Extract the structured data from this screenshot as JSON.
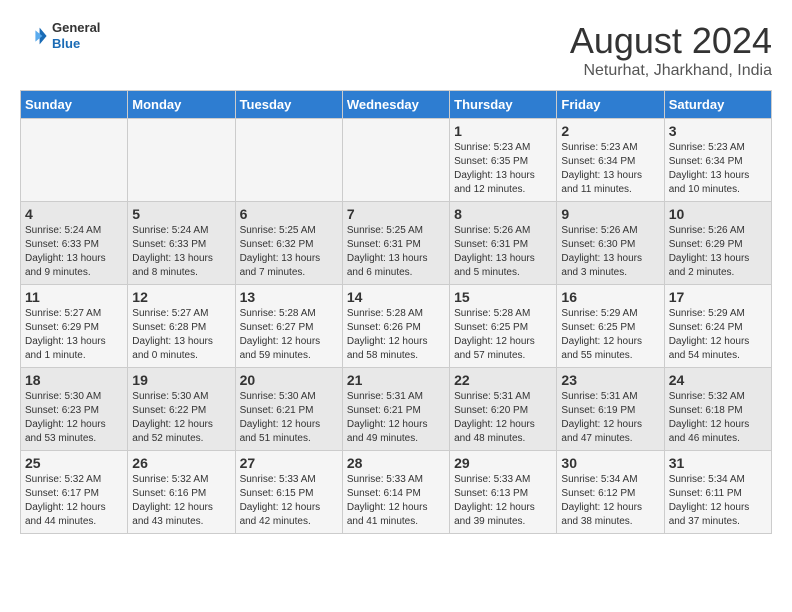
{
  "header": {
    "logo_general": "General",
    "logo_blue": "Blue",
    "title": "August 2024",
    "subtitle": "Neturhat, Jharkhand, India"
  },
  "calendar": {
    "days_of_week": [
      "Sunday",
      "Monday",
      "Tuesday",
      "Wednesday",
      "Thursday",
      "Friday",
      "Saturday"
    ],
    "weeks": [
      [
        {
          "day": "",
          "info": ""
        },
        {
          "day": "",
          "info": ""
        },
        {
          "day": "",
          "info": ""
        },
        {
          "day": "",
          "info": ""
        },
        {
          "day": "1",
          "info": "Sunrise: 5:23 AM\nSunset: 6:35 PM\nDaylight: 13 hours\nand 12 minutes."
        },
        {
          "day": "2",
          "info": "Sunrise: 5:23 AM\nSunset: 6:34 PM\nDaylight: 13 hours\nand 11 minutes."
        },
        {
          "day": "3",
          "info": "Sunrise: 5:23 AM\nSunset: 6:34 PM\nDaylight: 13 hours\nand 10 minutes."
        }
      ],
      [
        {
          "day": "4",
          "info": "Sunrise: 5:24 AM\nSunset: 6:33 PM\nDaylight: 13 hours\nand 9 minutes."
        },
        {
          "day": "5",
          "info": "Sunrise: 5:24 AM\nSunset: 6:33 PM\nDaylight: 13 hours\nand 8 minutes."
        },
        {
          "day": "6",
          "info": "Sunrise: 5:25 AM\nSunset: 6:32 PM\nDaylight: 13 hours\nand 7 minutes."
        },
        {
          "day": "7",
          "info": "Sunrise: 5:25 AM\nSunset: 6:31 PM\nDaylight: 13 hours\nand 6 minutes."
        },
        {
          "day": "8",
          "info": "Sunrise: 5:26 AM\nSunset: 6:31 PM\nDaylight: 13 hours\nand 5 minutes."
        },
        {
          "day": "9",
          "info": "Sunrise: 5:26 AM\nSunset: 6:30 PM\nDaylight: 13 hours\nand 3 minutes."
        },
        {
          "day": "10",
          "info": "Sunrise: 5:26 AM\nSunset: 6:29 PM\nDaylight: 13 hours\nand 2 minutes."
        }
      ],
      [
        {
          "day": "11",
          "info": "Sunrise: 5:27 AM\nSunset: 6:29 PM\nDaylight: 13 hours\nand 1 minute."
        },
        {
          "day": "12",
          "info": "Sunrise: 5:27 AM\nSunset: 6:28 PM\nDaylight: 13 hours\nand 0 minutes."
        },
        {
          "day": "13",
          "info": "Sunrise: 5:28 AM\nSunset: 6:27 PM\nDaylight: 12 hours\nand 59 minutes."
        },
        {
          "day": "14",
          "info": "Sunrise: 5:28 AM\nSunset: 6:26 PM\nDaylight: 12 hours\nand 58 minutes."
        },
        {
          "day": "15",
          "info": "Sunrise: 5:28 AM\nSunset: 6:25 PM\nDaylight: 12 hours\nand 57 minutes."
        },
        {
          "day": "16",
          "info": "Sunrise: 5:29 AM\nSunset: 6:25 PM\nDaylight: 12 hours\nand 55 minutes."
        },
        {
          "day": "17",
          "info": "Sunrise: 5:29 AM\nSunset: 6:24 PM\nDaylight: 12 hours\nand 54 minutes."
        }
      ],
      [
        {
          "day": "18",
          "info": "Sunrise: 5:30 AM\nSunset: 6:23 PM\nDaylight: 12 hours\nand 53 minutes."
        },
        {
          "day": "19",
          "info": "Sunrise: 5:30 AM\nSunset: 6:22 PM\nDaylight: 12 hours\nand 52 minutes."
        },
        {
          "day": "20",
          "info": "Sunrise: 5:30 AM\nSunset: 6:21 PM\nDaylight: 12 hours\nand 51 minutes."
        },
        {
          "day": "21",
          "info": "Sunrise: 5:31 AM\nSunset: 6:21 PM\nDaylight: 12 hours\nand 49 minutes."
        },
        {
          "day": "22",
          "info": "Sunrise: 5:31 AM\nSunset: 6:20 PM\nDaylight: 12 hours\nand 48 minutes."
        },
        {
          "day": "23",
          "info": "Sunrise: 5:31 AM\nSunset: 6:19 PM\nDaylight: 12 hours\nand 47 minutes."
        },
        {
          "day": "24",
          "info": "Sunrise: 5:32 AM\nSunset: 6:18 PM\nDaylight: 12 hours\nand 46 minutes."
        }
      ],
      [
        {
          "day": "25",
          "info": "Sunrise: 5:32 AM\nSunset: 6:17 PM\nDaylight: 12 hours\nand 44 minutes."
        },
        {
          "day": "26",
          "info": "Sunrise: 5:32 AM\nSunset: 6:16 PM\nDaylight: 12 hours\nand 43 minutes."
        },
        {
          "day": "27",
          "info": "Sunrise: 5:33 AM\nSunset: 6:15 PM\nDaylight: 12 hours\nand 42 minutes."
        },
        {
          "day": "28",
          "info": "Sunrise: 5:33 AM\nSunset: 6:14 PM\nDaylight: 12 hours\nand 41 minutes."
        },
        {
          "day": "29",
          "info": "Sunrise: 5:33 AM\nSunset: 6:13 PM\nDaylight: 12 hours\nand 39 minutes."
        },
        {
          "day": "30",
          "info": "Sunrise: 5:34 AM\nSunset: 6:12 PM\nDaylight: 12 hours\nand 38 minutes."
        },
        {
          "day": "31",
          "info": "Sunrise: 5:34 AM\nSunset: 6:11 PM\nDaylight: 12 hours\nand 37 minutes."
        }
      ]
    ]
  }
}
